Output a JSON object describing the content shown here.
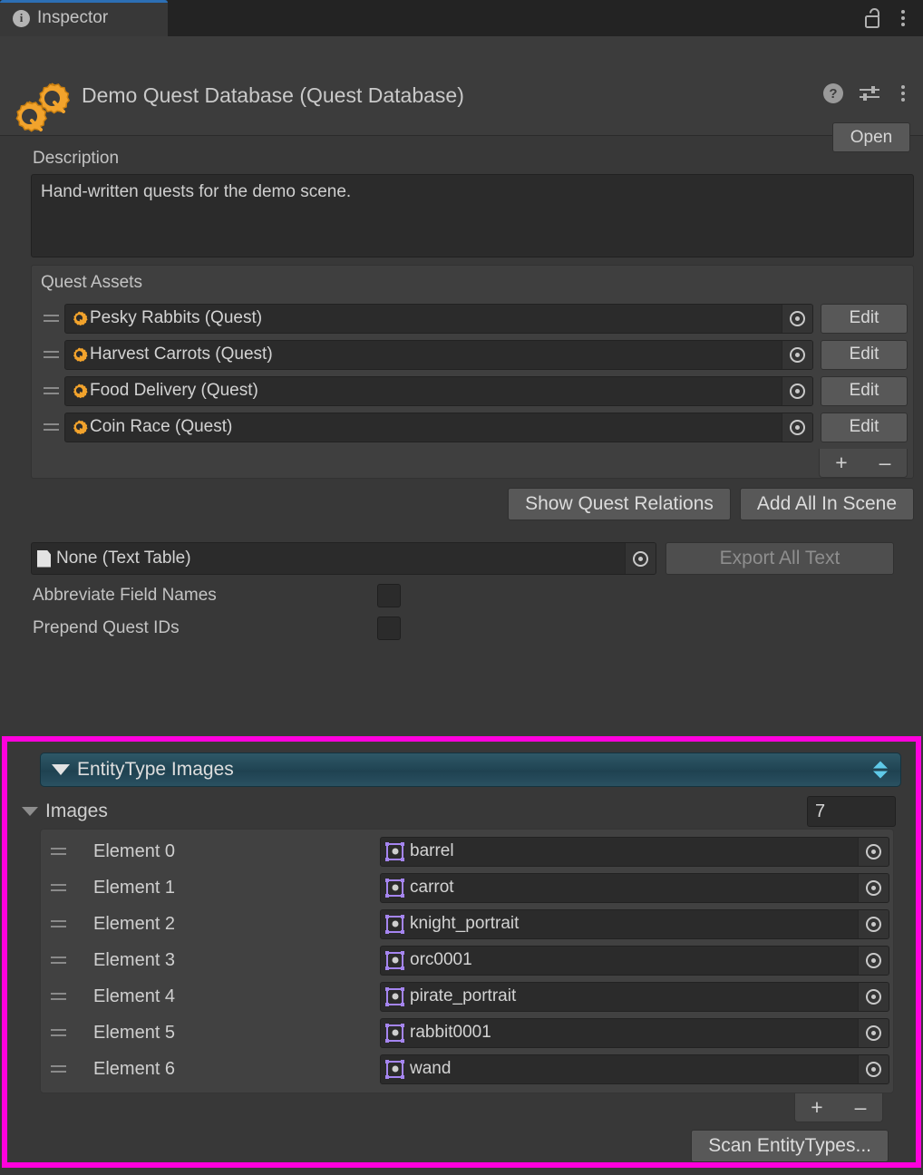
{
  "window": {
    "tab_label": "Inspector",
    "tab_icon": "info-icon",
    "lock_icon": "unlocked-padlock-icon",
    "menu_icon": "kebab-menu-icon"
  },
  "object_header": {
    "icon": "quest-database-gears-icon",
    "title": "Demo Quest Database (Quest Database)",
    "help_icon": "help-circle-icon",
    "preset_icon": "preset-sliders-icon",
    "menu_icon": "kebab-menu-icon",
    "open_button": "Open"
  },
  "description": {
    "label": "Description",
    "value": "Hand-written quests for the demo scene."
  },
  "quest_assets": {
    "panel_title": "Quest Assets",
    "items": [
      {
        "name": "Pesky Rabbits (Quest)",
        "icon": "quest-gear-icon",
        "edit_label": "Edit"
      },
      {
        "name": "Harvest Carrots (Quest)",
        "icon": "quest-gear-icon",
        "edit_label": "Edit"
      },
      {
        "name": "Food Delivery (Quest)",
        "icon": "quest-gear-icon",
        "edit_label": "Edit"
      },
      {
        "name": "Coin Race (Quest)",
        "icon": "quest-gear-icon",
        "edit_label": "Edit"
      }
    ],
    "add_label": "+",
    "remove_label": "–",
    "show_relations_button": "Show Quest Relations",
    "add_all_in_scene_button": "Add All In Scene"
  },
  "text_table": {
    "value": "None (Text Table)",
    "icon": "text-asset-document-icon",
    "export_button": "Export All Text",
    "export_disabled": true,
    "abbreviate_label": "Abbreviate Field Names",
    "abbreviate_checked": false,
    "prepend_label": "Prepend Quest IDs",
    "prepend_checked": false
  },
  "entity_type_images": {
    "foldout_title": "EntityType Images",
    "foldout_expanded": true,
    "sort_icon": "sort-up-down-icon",
    "images_label": "Images",
    "images_expanded": true,
    "count": "7",
    "elements": [
      {
        "label": "Element 0",
        "value": "barrel",
        "icon": "sprite-icon"
      },
      {
        "label": "Element 1",
        "value": "carrot",
        "icon": "sprite-icon"
      },
      {
        "label": "Element 2",
        "value": "knight_portrait",
        "icon": "sprite-icon"
      },
      {
        "label": "Element 3",
        "value": "orc0001",
        "icon": "sprite-icon"
      },
      {
        "label": "Element 4",
        "value": "pirate_portrait",
        "icon": "sprite-icon"
      },
      {
        "label": "Element 5",
        "value": "rabbit0001",
        "icon": "sprite-icon"
      },
      {
        "label": "Element 6",
        "value": "wand",
        "icon": "sprite-icon"
      }
    ],
    "add_label": "+",
    "remove_label": "–",
    "scan_button": "Scan EntityTypes...",
    "highlight_color": "#ff00dd"
  }
}
